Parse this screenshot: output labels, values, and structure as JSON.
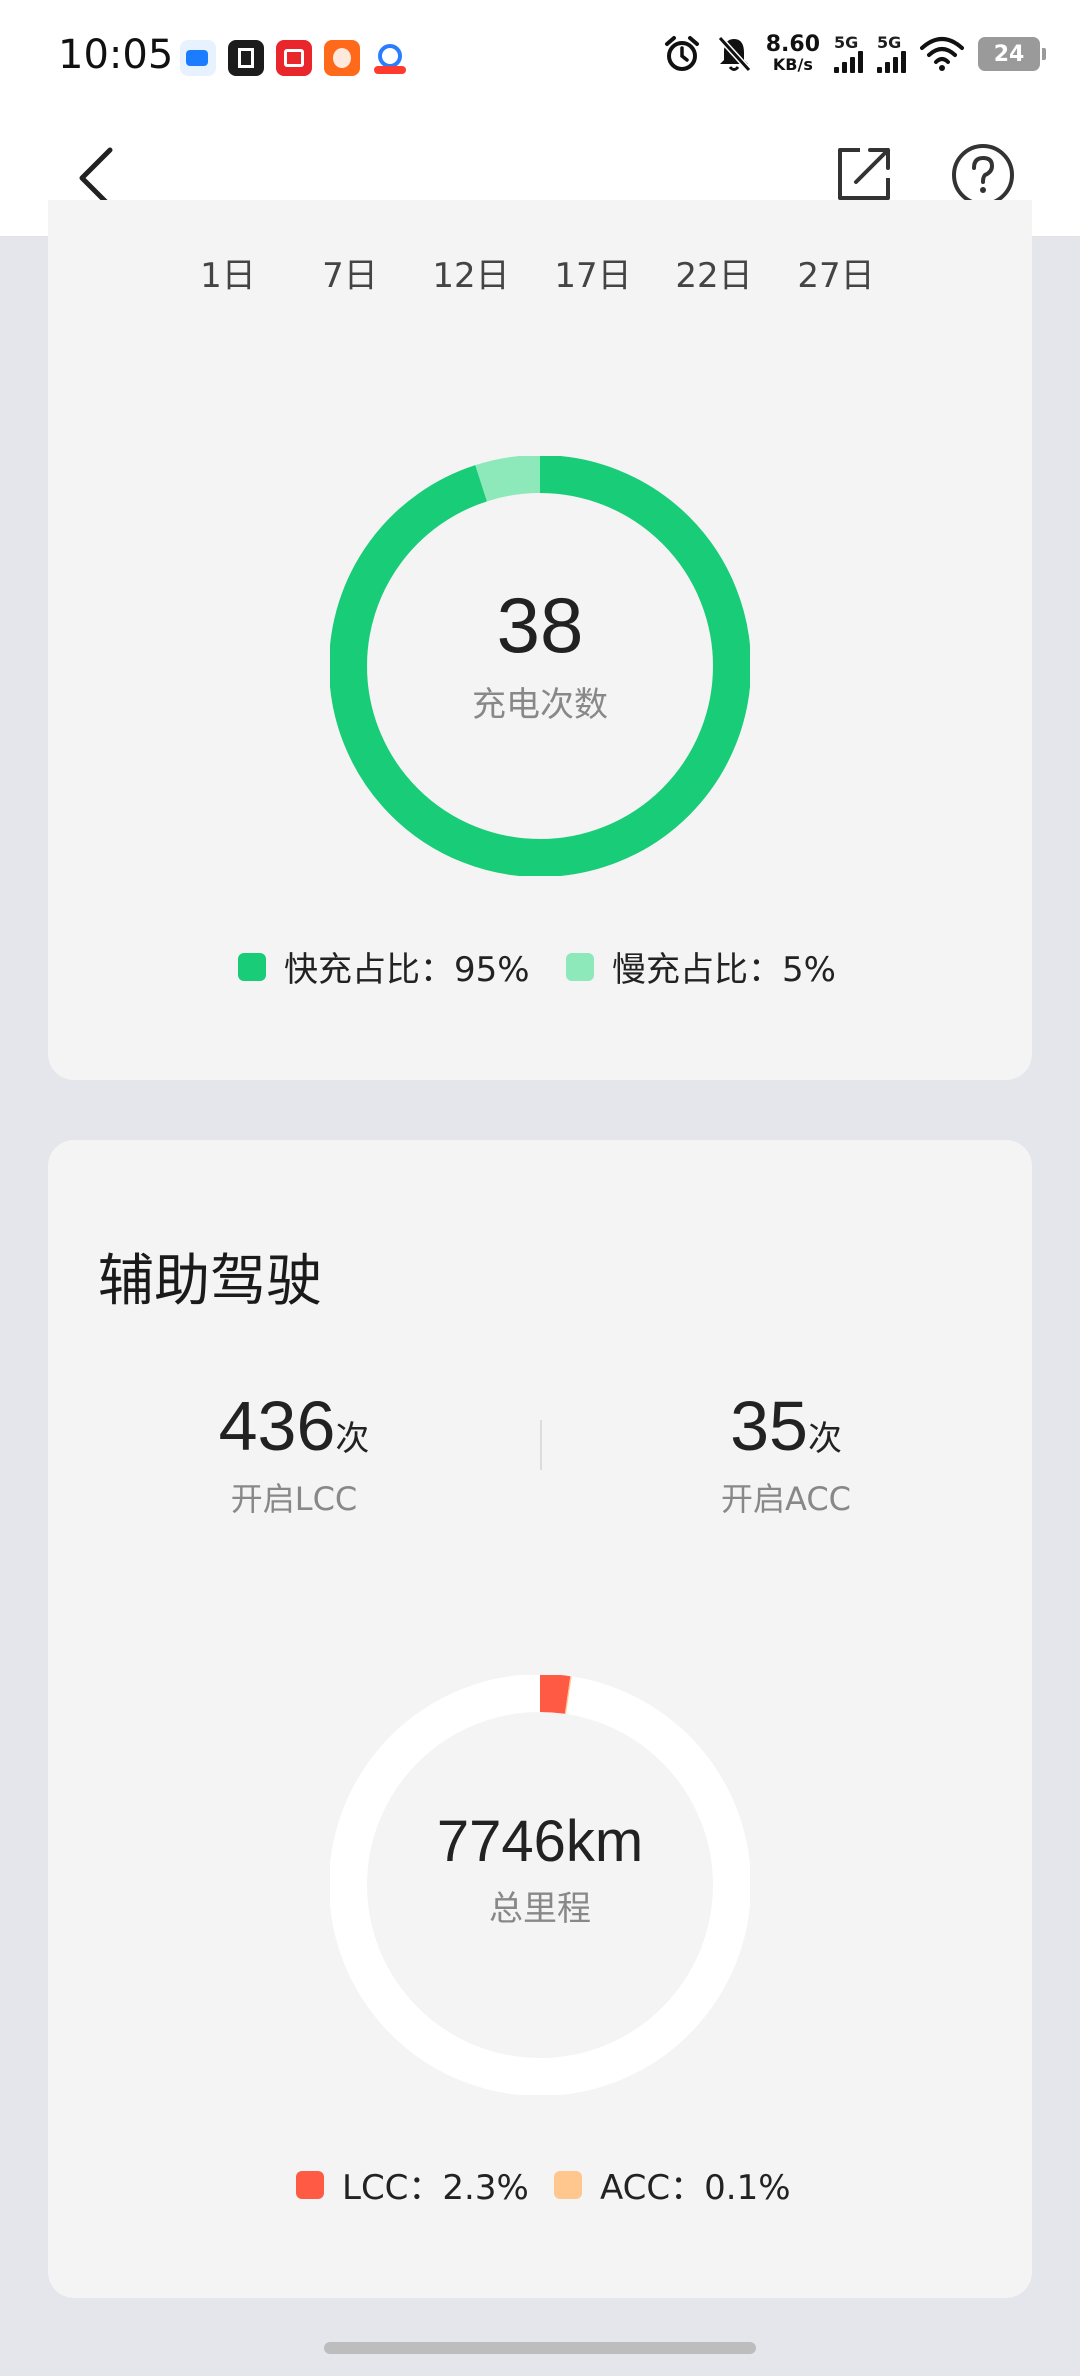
{
  "status_bar": {
    "time": "10:05",
    "net_speed_value": "8.60",
    "net_speed_unit": "KB/s",
    "sim1": "5G",
    "sim2": "5G",
    "battery": "24"
  },
  "nav": {
    "back_icon": "chevron-left-icon",
    "share_icon": "share-external-icon",
    "help_icon": "question-circle-icon"
  },
  "charging": {
    "axis_ticks": [
      "1日",
      "7日",
      "12日",
      "17日",
      "22日",
      "27日"
    ],
    "count": "38",
    "count_label": "充电次数",
    "fast_legend": "快充占比：95%",
    "slow_legend": "慢充占比：5%",
    "fast_fraction": 0.95,
    "slow_fraction": 0.05,
    "colors": {
      "fast": "#18CC78",
      "slow": "#8DE8BA"
    }
  },
  "assist": {
    "title": "辅助驾驶",
    "lcc_count": "436",
    "lcc_unit": "次",
    "lcc_label": "开启LCC",
    "acc_count": "35",
    "acc_unit": "次",
    "acc_label": "开启ACC",
    "total_mileage": "7746km",
    "mileage_label": "总里程",
    "lcc_legend": "LCC：2.3%",
    "acc_legend": "ACC：0.1%",
    "lcc_fraction": 0.023,
    "acc_fraction": 0.001,
    "colors": {
      "lcc": "#FF5A43",
      "acc": "#FFC78E",
      "track": "#FFFFFF"
    }
  }
}
